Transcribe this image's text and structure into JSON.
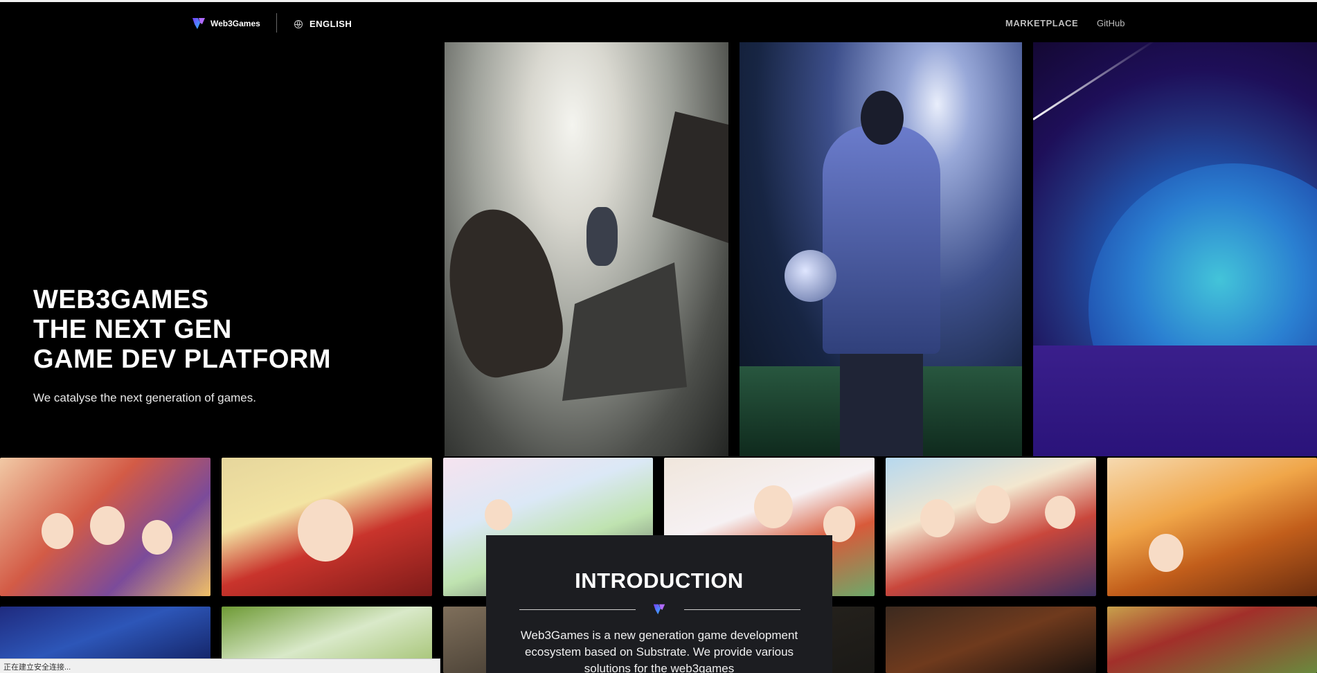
{
  "header": {
    "brand": "Web3Games",
    "language": "ENGLISH",
    "nav": {
      "marketplace": "MARKETPLACE",
      "github": "GitHub"
    }
  },
  "hero": {
    "title_lines": [
      "WEB3GAMES",
      "THE NEXT GEN",
      "GAME DEV PLATFORM"
    ],
    "subtitle": "We catalyse the next generation of games."
  },
  "introduction": {
    "title": "INTRODUCTION",
    "body": "Web3Games is a new generation game development ecosystem based on Substrate. We provide various solutions for the web3games"
  },
  "status_bar": {
    "text": "正在建立安全连接..."
  },
  "colors": {
    "background": "#000000",
    "panel": "#1c1d21",
    "brand_gradient_start": "#7b3cff",
    "brand_gradient_end": "#30b5ff"
  },
  "icons": {
    "logo": "web3games-logo-icon",
    "language": "globe-icon"
  }
}
